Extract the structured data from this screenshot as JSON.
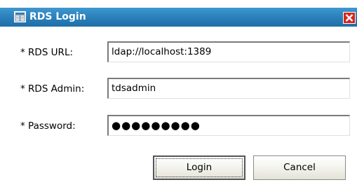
{
  "window": {
    "title": "RDS Login",
    "title_bar_color": "#2b80bb",
    "icons": {
      "title": "login-dialog-icon",
      "close": "close-icon"
    }
  },
  "form": {
    "url_label": "* RDS URL:",
    "url_value": "ldap://localhost:1389",
    "admin_label": "* RDS Admin:",
    "admin_value": "tdsadmin",
    "password_label": "* Password:",
    "password_value": "●●●●●●●●●"
  },
  "buttons": {
    "login": "Login",
    "cancel": "Cancel"
  }
}
